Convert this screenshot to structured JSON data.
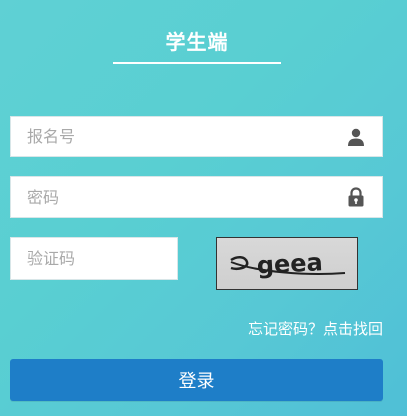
{
  "header": {
    "title": "学生端"
  },
  "form": {
    "username": {
      "placeholder": "报名号",
      "value": "",
      "icon": "user-icon"
    },
    "password": {
      "placeholder": "密码",
      "value": "",
      "icon": "lock-icon"
    },
    "captcha": {
      "placeholder": "验证码",
      "value": ""
    },
    "captcha_image": {
      "text": "geea"
    },
    "forgot_label": "忘记密码？点击找回",
    "login_label": "登录"
  },
  "colors": {
    "background_start": "#5fd0d4",
    "background_end": "#4fbfd6",
    "login_button": "#1e7ec8",
    "text_light": "#ffffff",
    "icon": "#555555"
  }
}
